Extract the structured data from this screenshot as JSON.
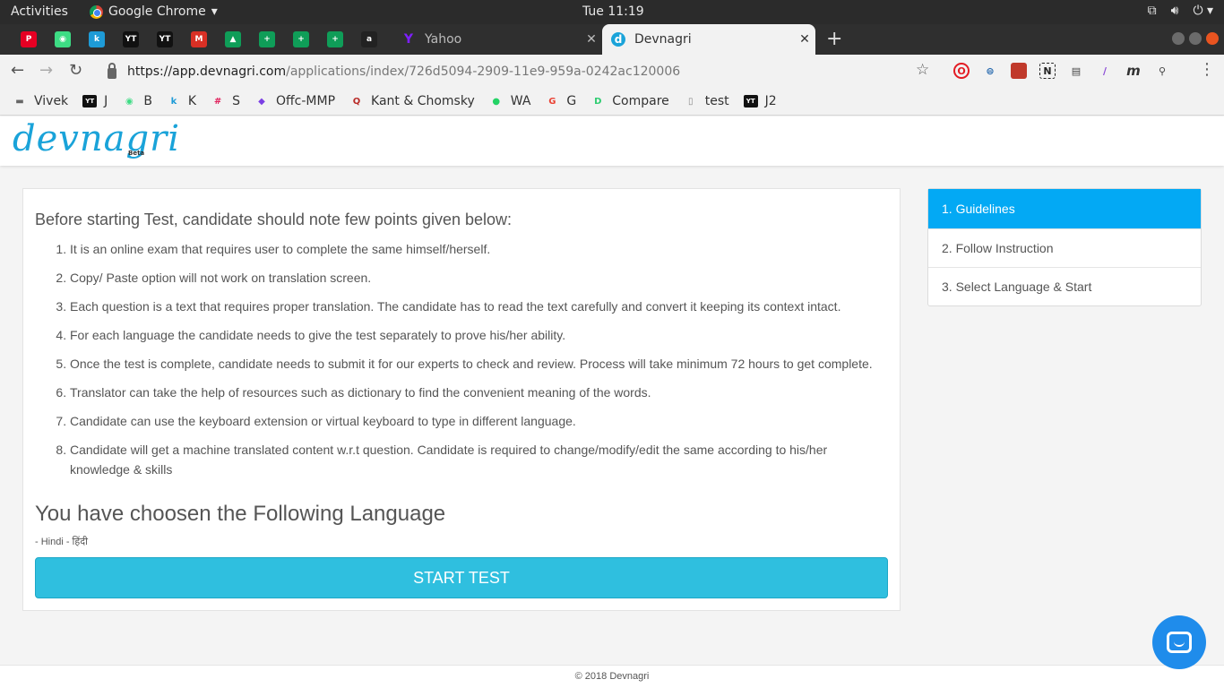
{
  "system_bar": {
    "activities": "Activities",
    "app_name": "Google Chrome",
    "clock": "Tue 11:19"
  },
  "tabs": [
    {
      "title": "Yahoo",
      "favicon": "Y"
    },
    {
      "title": "Devnagri",
      "favicon": "d"
    }
  ],
  "pinned_tabs": [
    {
      "icon": "pinterest-icon",
      "glyph": "P",
      "color": "#e60023"
    },
    {
      "icon": "android-icon",
      "glyph": "◉",
      "color": "#3ddc84"
    },
    {
      "icon": "k-icon",
      "glyph": "k",
      "color": "#1e9bd7"
    },
    {
      "icon": "youtrack-icon",
      "glyph": "YT",
      "color": "#111111"
    },
    {
      "icon": "youtrack-icon",
      "glyph": "YT",
      "color": "#111111"
    },
    {
      "icon": "gmail-icon",
      "glyph": "M",
      "color": "#d93025"
    },
    {
      "icon": "drive-icon",
      "glyph": "▲",
      "color": "#0f9d58"
    },
    {
      "icon": "sheets-icon",
      "glyph": "+",
      "color": "#0f9d58"
    },
    {
      "icon": "sheets-icon",
      "glyph": "+",
      "color": "#0f9d58"
    },
    {
      "icon": "sheets-icon",
      "glyph": "+",
      "color": "#0f9d58"
    },
    {
      "icon": "amazon-icon",
      "glyph": "a",
      "color": "#222222"
    }
  ],
  "address_bar": {
    "url_scheme_host": "https://app.devnagri.com",
    "url_path": "/applications/index/726d5094-2909-11e9-959a-0242ac120006"
  },
  "bookmarks": [
    {
      "label": "Vivek",
      "icon": "folder-icon"
    },
    {
      "label": "J",
      "icon": "youtrack-icon"
    },
    {
      "label": "B",
      "icon": "android-icon"
    },
    {
      "label": "K",
      "icon": "k-icon"
    },
    {
      "label": "S",
      "icon": "slack-icon"
    },
    {
      "label": "Offc-MMP",
      "icon": "mmp-icon"
    },
    {
      "label": "Kant & Chomsky",
      "icon": "quora-icon"
    },
    {
      "label": "WA",
      "icon": "whatsapp-icon"
    },
    {
      "label": "G",
      "icon": "google-icon"
    },
    {
      "label": "Compare",
      "icon": "diffchecker-icon"
    },
    {
      "label": "test",
      "icon": "page-icon"
    },
    {
      "label": "J2",
      "icon": "youtrack-icon"
    }
  ],
  "site": {
    "logo_text": "devnagri",
    "logo_badge": "Beta",
    "intro_heading": "Before starting Test, candidate should note few points given below:",
    "guidelines": [
      "It is an online exam that requires user to complete the same himself/herself.",
      "Copy/ Paste option will not work on translation screen.",
      "Each question is a text that requires proper translation. The candidate has to read the text carefully and convert it keeping its context intact.",
      "For each language the candidate needs to give the test separately to prove his/her ability.",
      "Once the test is complete, candidate needs to submit it for our experts to check and review. Process will take minimum 72 hours to get complete.",
      "Translator can take the help of resources such as dictionary to find the convenient meaning of the words.",
      "Candidate can use the keyboard extension or virtual keyboard to type in different language.",
      "Candidate will get a machine translated content w.r.t question. Candidate is required to change/modify/edit the same according to his/her knowledge & skills"
    ],
    "chosen_heading": "You have choosen the Following Language",
    "chosen_language": "- Hindi - हिंदी",
    "start_button": "START TEST",
    "steps": [
      "1. Guidelines",
      "2. Follow Instruction",
      "3. Select Language & Start"
    ],
    "footer": "© 2018 Devnagri"
  },
  "colors": {
    "accent": "#03a9f4",
    "start_button": "#2fbfdf",
    "logo": "#1aa3d9",
    "chat": "#1f8ceb"
  }
}
